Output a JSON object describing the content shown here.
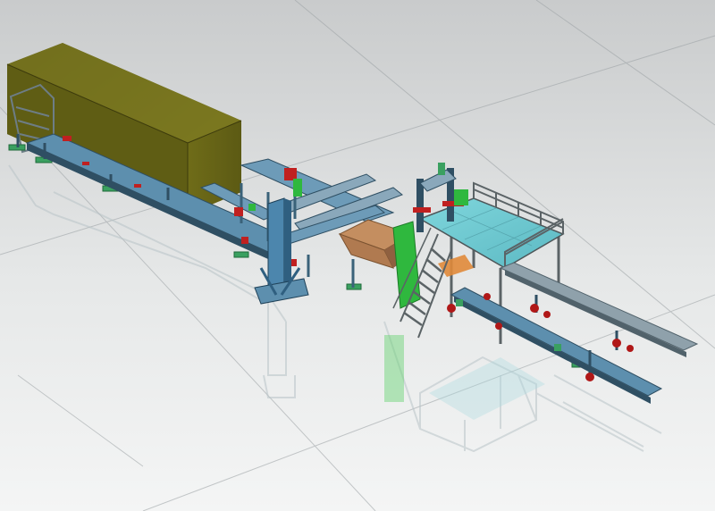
{
  "scene": {
    "kind": "3D CAD rendering of an industrial production line",
    "colors": {
      "background_top": "#c9cbcc",
      "background_bottom": "#f4f5f5",
      "grid": "#9aa0a3",
      "container": "#6f6c18",
      "container_top": "#858325",
      "conveyor_steel": "#5d8fae",
      "conveyor_dark": "#2f4f63",
      "rail": "#8fa1ab",
      "support_feet": "#3aa060",
      "panel_green": "#2fb83e",
      "platform_floor": "#6fc7cf",
      "platform_frame": "#6a7275",
      "table_top": "#b07a50",
      "accent_red": "#c02020",
      "reflection": "#d9dcdd"
    },
    "parts": [
      "container",
      "main-conveyor",
      "gantry-column",
      "transfer-table",
      "green-guard-panel",
      "elevated-platform",
      "access-stair",
      "outfeed-rails"
    ]
  }
}
